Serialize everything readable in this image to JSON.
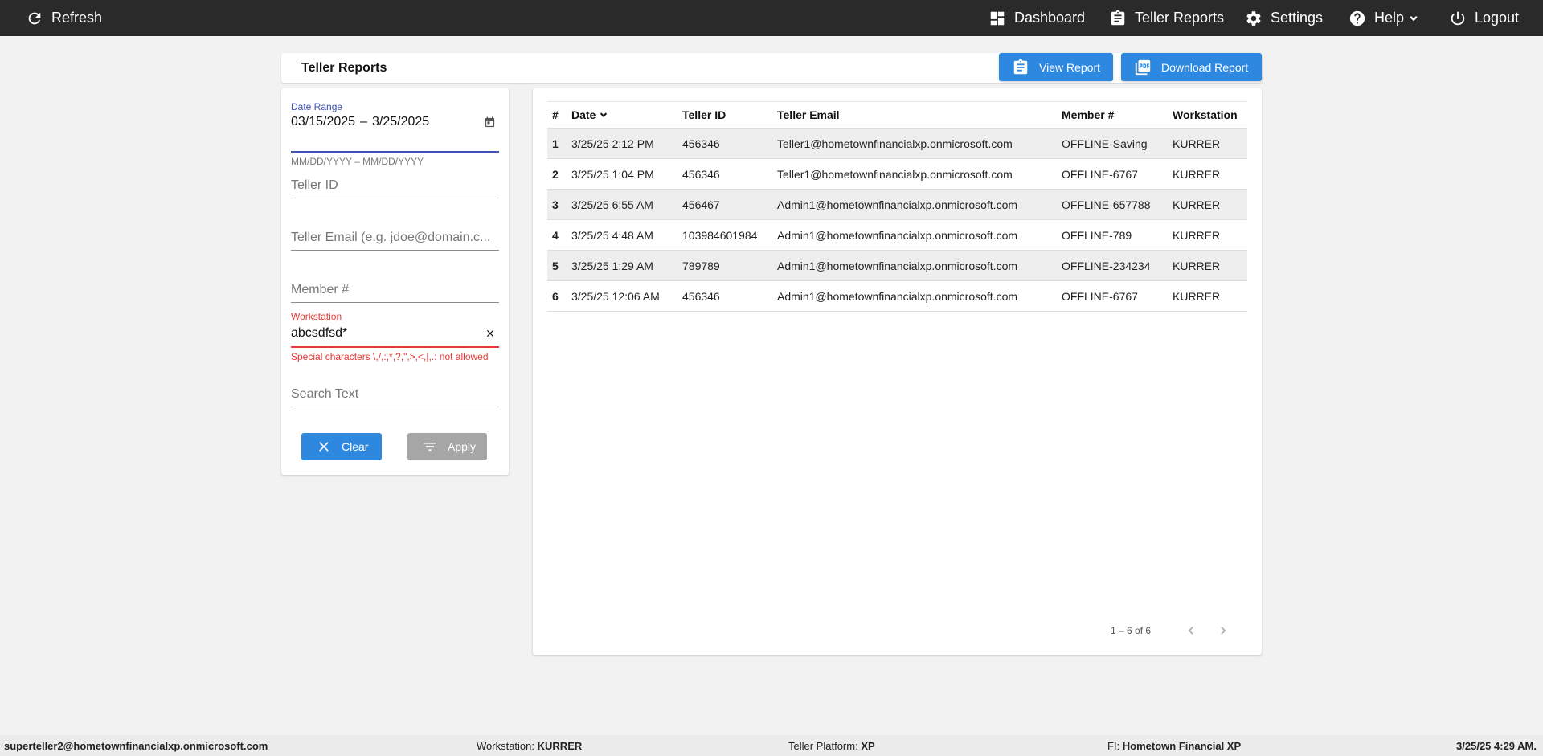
{
  "nav": {
    "refresh": "Refresh",
    "dashboard": "Dashboard",
    "teller_reports": "Teller Reports",
    "settings": "Settings",
    "help": "Help",
    "logout": "Logout"
  },
  "header": {
    "title": "Teller Reports",
    "view_report": "View Report",
    "download_report": "Download Report"
  },
  "filters": {
    "date_range_label": "Date Range",
    "date_start": "03/15/2025",
    "date_sep": "–",
    "date_end": "3/25/2025",
    "date_hint": "MM/DD/YYYY – MM/DD/YYYY",
    "teller_id_placeholder": "Teller ID",
    "teller_email_placeholder": "Teller Email (e.g. jdoe@domain.c...",
    "member_placeholder": "Member #",
    "workstation_label": "Workstation",
    "workstation_value": "abcsdfsd*",
    "workstation_error": "Special characters \\,/,:,*,?,\",>,<,|,.: not allowed",
    "search_placeholder": "Search Text",
    "clear": "Clear",
    "apply": "Apply"
  },
  "table": {
    "headers": [
      "#",
      "Date",
      "Teller ID",
      "Teller Email",
      "Member #",
      "Workstation"
    ],
    "rows": [
      {
        "n": "1",
        "date": "3/25/25 2:12 PM",
        "teller_id": "456346",
        "email": "Teller1@hometownfinancialxp.onmicrosoft.com",
        "member": "OFFLINE-Saving",
        "ws": "KURRER"
      },
      {
        "n": "2",
        "date": "3/25/25 1:04 PM",
        "teller_id": "456346",
        "email": "Teller1@hometownfinancialxp.onmicrosoft.com",
        "member": "OFFLINE-6767",
        "ws": "KURRER"
      },
      {
        "n": "3",
        "date": "3/25/25 6:55 AM",
        "teller_id": "456467",
        "email": "Admin1@hometownfinancialxp.onmicrosoft.com",
        "member": "OFFLINE-657788",
        "ws": "KURRER"
      },
      {
        "n": "4",
        "date": "3/25/25 4:48 AM",
        "teller_id": "103984601984",
        "email": "Admin1@hometownfinancialxp.onmicrosoft.com",
        "member": "OFFLINE-789",
        "ws": "KURRER"
      },
      {
        "n": "5",
        "date": "3/25/25 1:29 AM",
        "teller_id": "789789",
        "email": "Admin1@hometownfinancialxp.onmicrosoft.com",
        "member": "OFFLINE-234234",
        "ws": "KURRER"
      },
      {
        "n": "6",
        "date": "3/25/25 12:06 AM",
        "teller_id": "456346",
        "email": "Admin1@hometownfinancialxp.onmicrosoft.com",
        "member": "OFFLINE-6767",
        "ws": "KURRER"
      }
    ],
    "range": "1 – 6 of 6"
  },
  "status": {
    "user": "superteller2@hometownfinancialxp.onmicrosoft.com",
    "workstation_label": "Workstation:",
    "workstation": "KURRER",
    "platform_label": "Teller Platform:",
    "platform": "XP",
    "fi_label": "FI:",
    "fi": "Hometown Financial XP",
    "datetime": "3/25/25 4:29 AM."
  },
  "colors": {
    "accent": "#2e88e0",
    "topbar": "#2a2a2a",
    "error": "#e53935",
    "focus": "#3f51b5"
  }
}
